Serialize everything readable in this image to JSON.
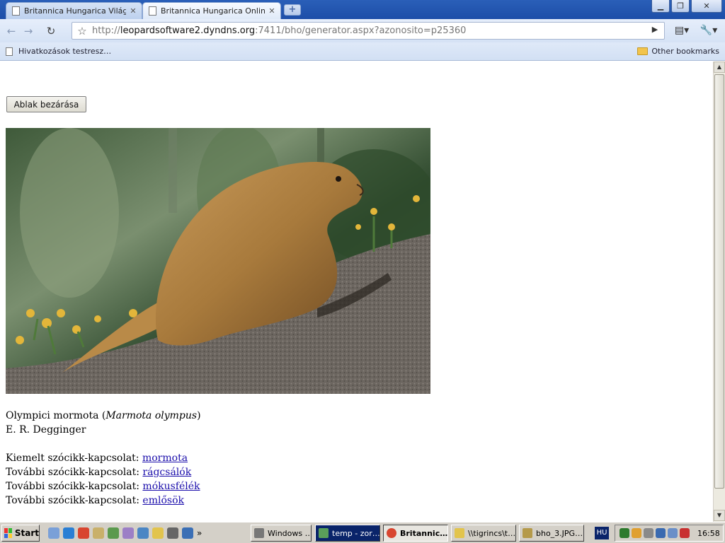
{
  "browser": {
    "tabs": [
      {
        "label": "Britannica Hungarica Világe…",
        "active": false
      },
      {
        "label": "Britannica Hungarica Online…",
        "active": true
      }
    ],
    "new_tab_symbol": "+",
    "address": {
      "scheme": "http://",
      "host": "leopardsoftware2.dyndns.org",
      "rest": ":7411/bho/generator.aspx?azonosito=p25360"
    },
    "bookmarks": {
      "left": "Hivatkozások testresz…",
      "right": "Other bookmarks"
    }
  },
  "content": {
    "close_button": "Ablak bezárása",
    "image_alt": "Olympici mormota",
    "caption_prefix": "Olympici mormota (",
    "caption_species": "Marmota olympus",
    "caption_suffix": ")",
    "credit": "E. R. Degginger",
    "links": [
      {
        "label": "Kiemelt szócikk-kapcsolat:",
        "link": "mormota"
      },
      {
        "label": "További szócikk-kapcsolat:",
        "link": "rágcsálók"
      },
      {
        "label": "További szócikk-kapcsolat:",
        "link": "mókusfélék"
      },
      {
        "label": "További szócikk-kapcsolat:",
        "link": "emlősök"
      }
    ]
  },
  "taskbar": {
    "start": "Start",
    "tasks": [
      "Windows …",
      "temp - zor…",
      "Britannic…",
      "\\\\tigrincs\\t…",
      "bho_3.JPG…"
    ],
    "lang": "HU",
    "clock": "16:58",
    "more_glyph": "»"
  }
}
